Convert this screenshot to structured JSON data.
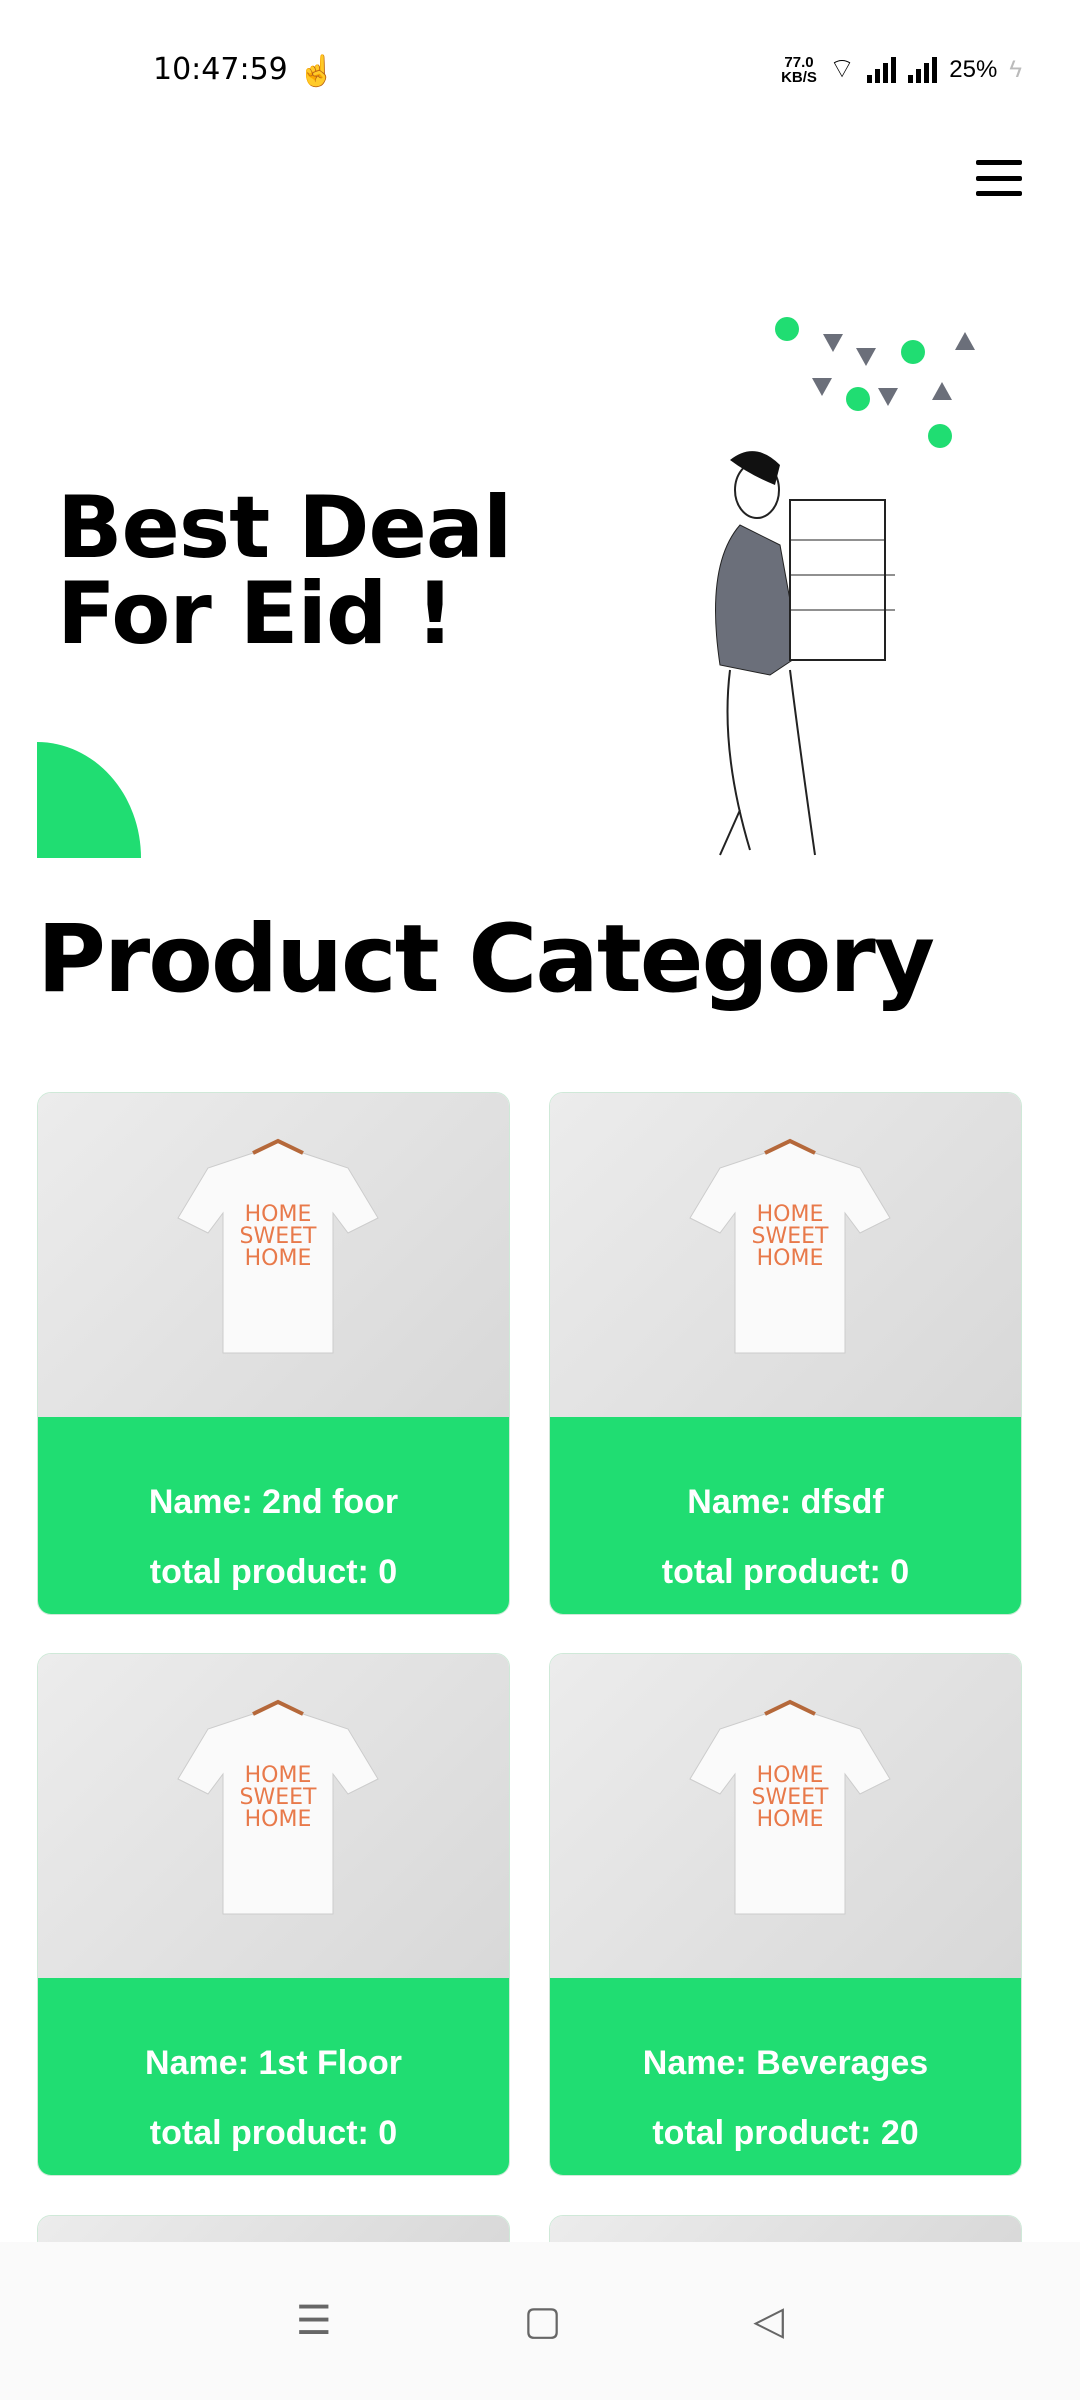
{
  "status": {
    "time": "10:47:59",
    "speed_value": "77.0",
    "speed_unit": "KB/S",
    "battery": "25%"
  },
  "hero": {
    "line1": "Best Deal",
    "line2": "For Eid !"
  },
  "section_title": "Product Category",
  "shirt_print": [
    "HOME",
    "SWEET",
    "HOME"
  ],
  "categories": [
    {
      "name": "Name: 2nd foor",
      "total": "total product: 0"
    },
    {
      "name": "Name: dfsdf",
      "total": "total product: 0"
    },
    {
      "name": "Name: 1st Floor",
      "total": "total product: 0"
    },
    {
      "name": "Name: Beverages",
      "total": "total product: 20"
    }
  ],
  "colors": {
    "accent": "#20dd72",
    "gray": "#6b6f7a"
  }
}
